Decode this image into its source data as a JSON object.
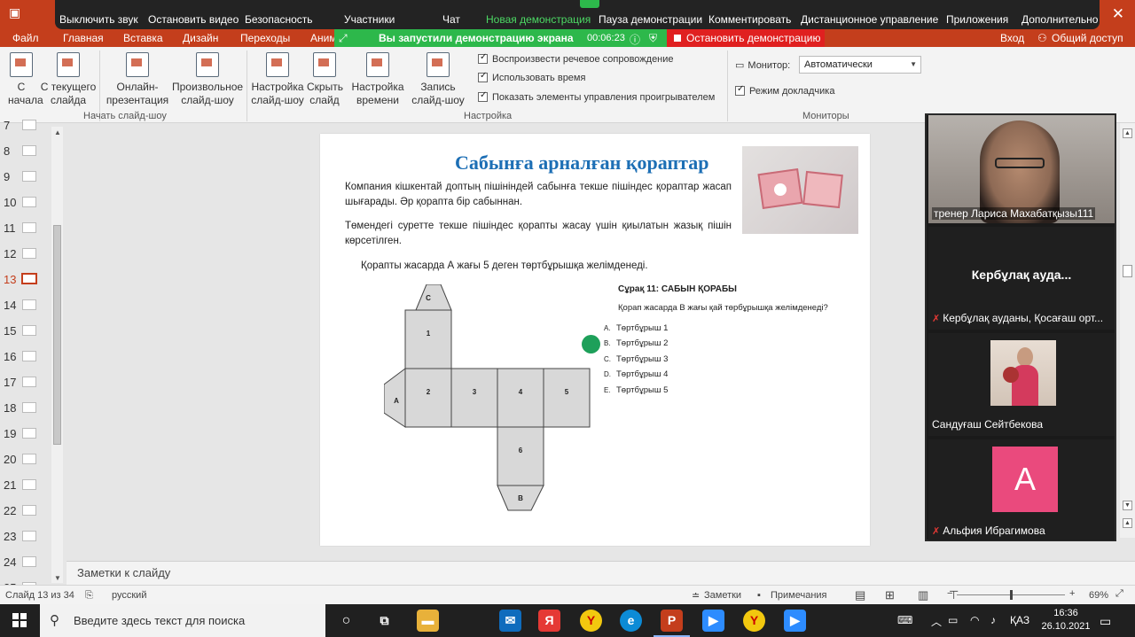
{
  "zoom_toolbar": {
    "items": [
      "Выключить звук",
      "Остановить видео",
      "Безопасность",
      "Участники",
      "Чат",
      "Новая демонстрация",
      "Пауза демонстрации",
      "Комментировать",
      "Дистанционное управление",
      "Приложения",
      "Дополнительно"
    ]
  },
  "menu": {
    "tabs": [
      "Файл",
      "Главная",
      "Вставка",
      "Дизайн",
      "Переходы",
      "Аним"
    ],
    "right_tabs": [
      "Вход",
      "Общий доступ"
    ]
  },
  "share_banner": {
    "text": "Вы запустили демонстрацию экрана",
    "time": "00:06:23",
    "stop": "Остановить демонстрацию"
  },
  "ribbon": {
    "btn_start": "С начала",
    "btn_current": "С текущего слайда",
    "btn_online": "Онлайн-презентация",
    "btn_custom": "Произвольное слайд-шоу",
    "group_start": "Начать слайд-шоу",
    "btn_setup": "Настройка слайд-шоу",
    "btn_hide": "Скрыть слайд",
    "btn_timing": "Настройка времени",
    "btn_record": "Запись слайд-шоу",
    "chk_narration": "Воспроизвести речевое сопровождение",
    "chk_timing": "Использовать время",
    "chk_controls": "Показать элементы управления проигрывателем",
    "group_setup": "Настройка",
    "monitor_label": "Монитор:",
    "monitor_value": "Автоматически",
    "presenter_view": "Режим докладчика",
    "group_monitors": "Мониторы"
  },
  "thumbnails": [
    "7",
    "8",
    "9",
    "10",
    "11",
    "12",
    "13",
    "14",
    "15",
    "16",
    "17",
    "18",
    "19",
    "20",
    "21",
    "22",
    "23",
    "24",
    "25"
  ],
  "active_slide": "13",
  "slide": {
    "title": "Сабынға арналған қораптар",
    "p1": "Компания кішкентай доптың пішініндей сабынға текше пішіндес қораптар жасап шығарады. Әр қорапта бір сабыннан.",
    "p2": "Төмендегі суретте текше пішіндес қорапты жасау үшін қиылатын жазық пішін көрсетілген.",
    "p3": "Қорапты жасарда А жағы 5 деген төртбұрышқа желімденеді.",
    "net_labels": [
      "C",
      "1",
      "2",
      "3",
      "4",
      "5",
      "A",
      "6",
      "B"
    ],
    "question_title": "Сұрақ 11: САБЫН ҚОРАБЫ",
    "question": "Қорап жасарда В жағы қай төрбұрышқа желімденеді?",
    "options": [
      {
        "letter": "A.",
        "text": "Төртбұрыш 1"
      },
      {
        "letter": "B.",
        "text": "Төртбұрыш 2"
      },
      {
        "letter": "C.",
        "text": "Төртбұрыш 3"
      },
      {
        "letter": "D.",
        "text": "Төртбұрыш 4"
      },
      {
        "letter": "E.",
        "text": "Төртбұрыш 5"
      }
    ]
  },
  "participants": [
    {
      "name": "тренер Лариса Махабатқызы111"
    },
    {
      "title": "Кербұлақ ауда...",
      "name": "Кербұлақ ауданы, Қосағаш орт..."
    },
    {
      "name": "Сандуғаш Сейтбекова"
    },
    {
      "avatar_letter": "А",
      "name": "Альфия Ибрагимова"
    }
  ],
  "notes_label": "Заметки к слайду",
  "status": {
    "slide_info": "Слайд 13 из 34",
    "language": "русский",
    "notes_btn": "Заметки",
    "comments_btn": "Примечания",
    "zoom": "69%"
  },
  "taskbar": {
    "search_placeholder": "Введите здесь текст для поиска",
    "lang": "ҚАЗ",
    "time": "16:36",
    "date": "26.10.2021"
  }
}
